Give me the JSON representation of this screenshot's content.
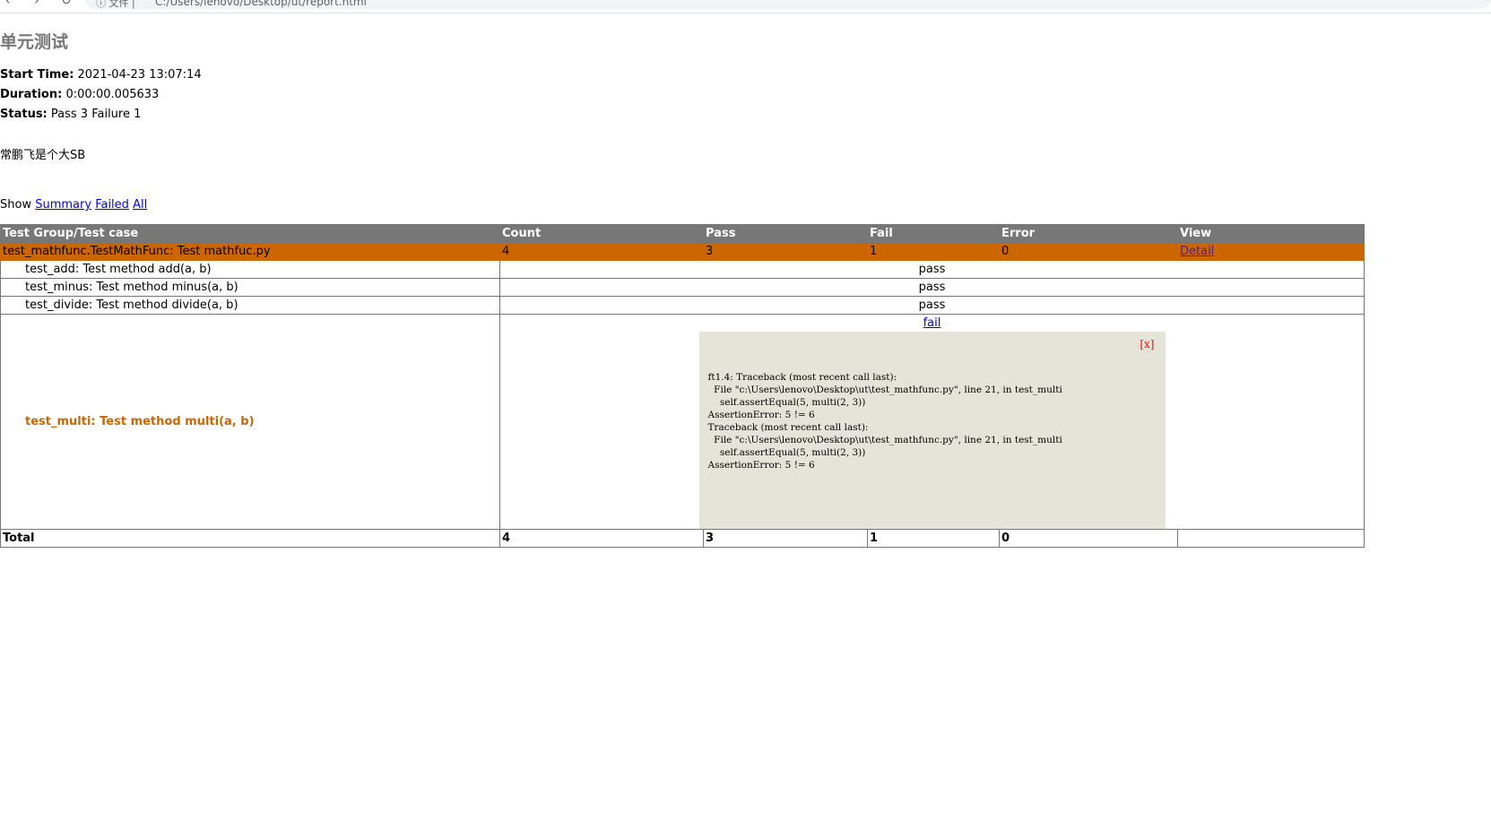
{
  "browser": {
    "nav_back": "‹",
    "nav_forward": "›",
    "reload": "↻",
    "info": "ⓘ 文件 |",
    "url": "C:/Users/lenovo/Desktop/ut/report.html"
  },
  "report": {
    "title": "单元测试",
    "start_time_label": "Start Time:",
    "start_time": "2021-04-23 13:07:14",
    "duration_label": "Duration:",
    "duration": "0:00:00.005633",
    "status_label": "Status:",
    "status": "Pass 3 Failure 1",
    "description": "常鹏飞是个大SB"
  },
  "show": {
    "label": "Show",
    "summary": "Summary",
    "failed": "Failed",
    "all": "All"
  },
  "table": {
    "headers": [
      "Test Group/Test case",
      "Count",
      "Pass",
      "Fail",
      "Error",
      "View"
    ],
    "class_row": {
      "name": "test_mathfunc.TestMathFunc: Test mathfuc.py",
      "count": "4",
      "pass": "3",
      "fail": "1",
      "error": "0",
      "view": "Detail"
    },
    "cases": [
      {
        "name": "test_add: Test method add(a, b)",
        "status": "pass"
      },
      {
        "name": "test_minus: Test method minus(a, b)",
        "status": "pass"
      },
      {
        "name": "test_divide: Test method divide(a, b)",
        "status": "pass"
      }
    ],
    "failed_case": {
      "name": "test_multi: Test method multi(a, b)",
      "status": "fail",
      "close": "[x]",
      "traceback": "ft1.4: Traceback (most recent call last):\n  File \"c:\\Users\\lenovo\\Desktop\\ut\\test_mathfunc.py\", line 21, in test_multi\n    self.assertEqual(5, multi(2, 3))\nAssertionError: 5 != 6\nTraceback (most recent call last):\n  File \"c:\\Users\\lenovo\\Desktop\\ut\\test_mathfunc.py\", line 21, in test_multi\n    self.assertEqual(5, multi(2, 3))\nAssertionError: 5 != 6"
    },
    "total": {
      "label": "Total",
      "count": "4",
      "pass": "3",
      "fail": "1",
      "error": "0",
      "view": ""
    }
  },
  "colors": {
    "header_bg": "#777777",
    "class_row_bg": "#cc6600",
    "popup_bg": "#e4e4d8",
    "close_color": "#ff0000"
  }
}
